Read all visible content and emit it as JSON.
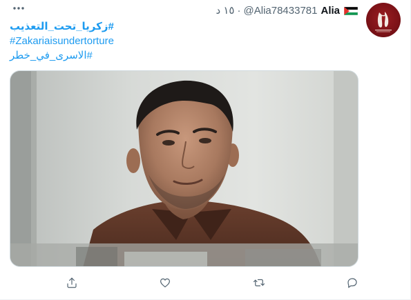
{
  "tweet": {
    "display_name": "Alia",
    "handle": "@Alia78433781",
    "separator": "·",
    "timestamp": "١٥ د",
    "flag_icon": "palestine-flag-icon",
    "more_icon": "more-horizontal-icon",
    "avatar_icon": "brand-logo-icon",
    "hashtags": [
      "#زكريا_تحت_التعذيب",
      "#Zakariaisundertorture",
      "#الاسرى_في_خطر"
    ],
    "media_description_icon": "portrait-photo",
    "actions": [
      {
        "name": "reply",
        "icon": "reply-icon"
      },
      {
        "name": "retweet",
        "icon": "retweet-icon"
      },
      {
        "name": "like",
        "icon": "like-icon"
      },
      {
        "name": "share",
        "icon": "share-icon"
      }
    ]
  },
  "colors": {
    "link": "#1d9bf0",
    "text_primary": "#0f1419",
    "text_secondary": "#536471",
    "avatar_bg": "#7c1217"
  }
}
